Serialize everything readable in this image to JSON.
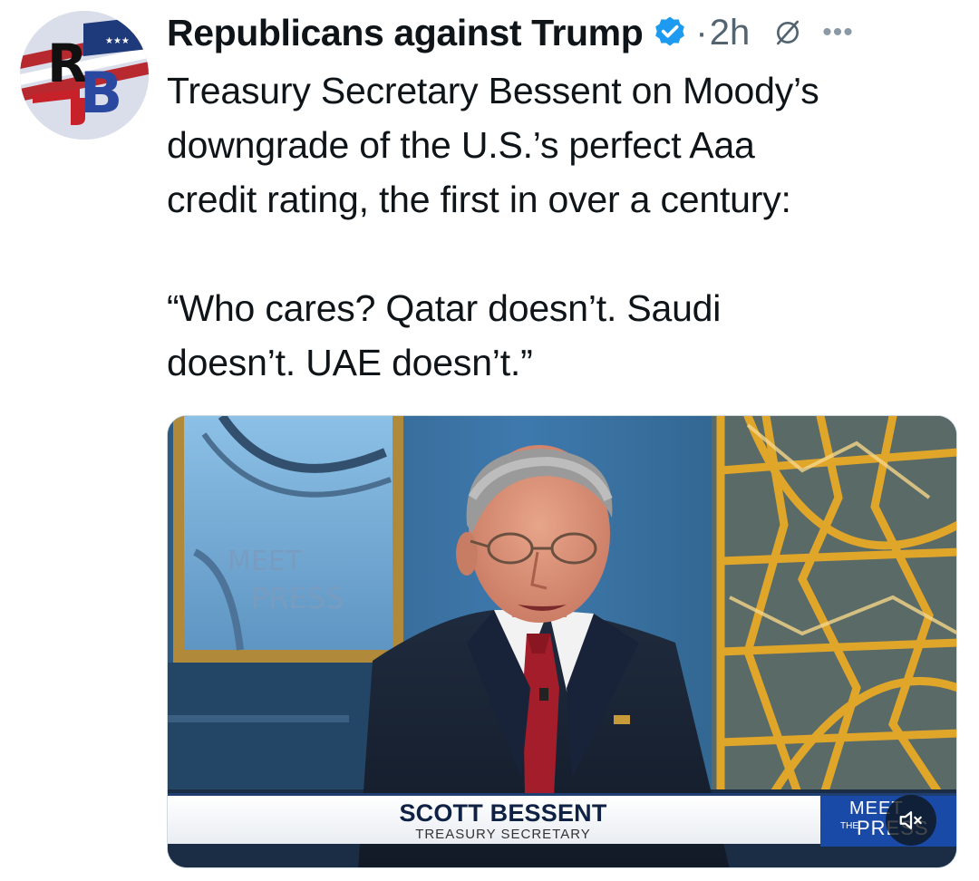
{
  "post": {
    "author": "Republicans against Trump",
    "separator": "·",
    "time": "2h",
    "avatar_text": "RB",
    "text_lines": [
      "Treasury Secretary Bessent on Moody’s",
      "downgrade of the U.S.’s perfect Aaa",
      "credit rating, the first in over a century:"
    ],
    "quote_lines": [
      "“Who cares? Qatar doesn’t. Saudi",
      "doesn’t. UAE doesn’t.”"
    ]
  },
  "icons": {
    "verified": "verified-badge-icon",
    "grok": "grok-icon",
    "more": "more-options-icon",
    "mute": "muted-speaker-icon"
  },
  "video": {
    "backdrop_logo": "MEET THE PRESS",
    "chyron": {
      "name": "SCOTT BESSENT",
      "title": "TREASURY SECRETARY",
      "logo_meet": "MEET",
      "logo_the": "THE",
      "logo_press": "PRESS"
    }
  },
  "colors": {
    "verified": "#1d9bf0",
    "text": "#0f1419",
    "muted": "#536471",
    "chyron_blue": "#1a4aa8"
  }
}
